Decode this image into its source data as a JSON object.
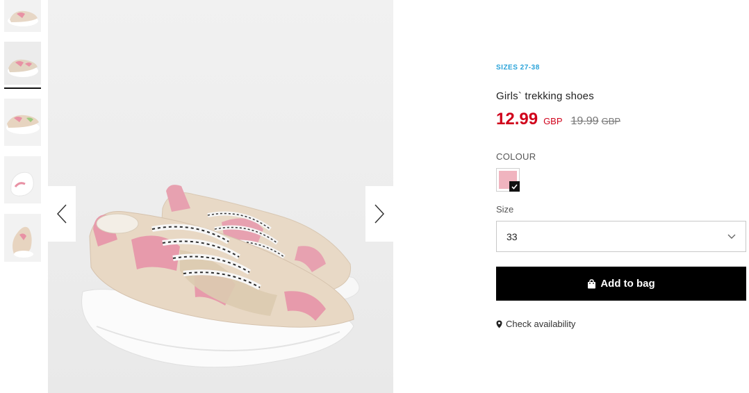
{
  "thumbnails": [
    {
      "name": "thumb-1"
    },
    {
      "name": "thumb-2",
      "active": true
    },
    {
      "name": "thumb-3"
    },
    {
      "name": "thumb-4"
    },
    {
      "name": "thumb-5"
    }
  ],
  "gallery": {
    "prev_icon": "chevron-left-icon",
    "next_icon": "chevron-right-icon"
  },
  "product": {
    "sizes_tag": "SIZES 27-38",
    "title": "Girls` trekking shoes",
    "price_now": "12.99",
    "price_now_currency": "GBP",
    "price_old": "19.99",
    "price_old_currency": "GBP"
  },
  "colour": {
    "label": "COLOUR",
    "swatch_color": "#f0b4bf",
    "selected": true
  },
  "size": {
    "label": "Size",
    "selected_value": "33"
  },
  "actions": {
    "add_to_bag": "Add to bag",
    "check_availability": "Check availability"
  },
  "colors": {
    "sale_red": "#d0021b",
    "sizes_blue": "#2aa3d9",
    "button_black": "#000000"
  }
}
